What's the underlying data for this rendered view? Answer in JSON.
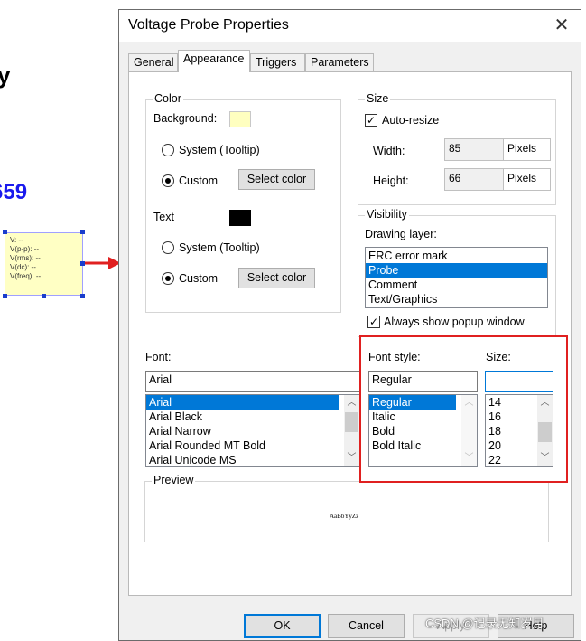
{
  "background": {
    "fragment_1": "y",
    "fragment_2": "659",
    "probe_lines": [
      "V: --",
      "V(p-p): --",
      "V(rms): --",
      "V(dc): --",
      "V(freq): --"
    ]
  },
  "dialog": {
    "title": "Voltage Probe Properties",
    "close_icon": "close-icon",
    "tabs": [
      "General",
      "Appearance",
      "Triggers",
      "Parameters"
    ],
    "active_tab": "Appearance"
  },
  "color_group": {
    "title": "Color",
    "background_label": "Background:",
    "background_color": "#ffffc0",
    "bg_system": "System (Tooltip)",
    "bg_custom": "Custom",
    "bg_select": "Select color",
    "text_label": "Text",
    "text_color": "#000000",
    "text_system": "System (Tooltip)",
    "text_custom": "Custom",
    "text_select": "Select color"
  },
  "size_group": {
    "title": "Size",
    "auto_resize": "Auto-resize",
    "width_label": "Width:",
    "width_value": "85",
    "height_label": "Height:",
    "height_value": "66",
    "unit": "Pixels"
  },
  "visibility_group": {
    "title": "Visibility",
    "drawing_layer_label": "Drawing layer:",
    "layers": [
      "ERC error mark",
      "Probe",
      "Comment",
      "Text/Graphics"
    ],
    "selected_layer": "Probe",
    "always_show": "Always show popup window"
  },
  "font": {
    "font_label": "Font:",
    "font_value": "Arial",
    "fonts": [
      "Arial",
      "Arial Black",
      "Arial Narrow",
      "Arial Rounded MT Bold",
      "Arial Unicode MS"
    ],
    "style_label": "Font style:",
    "style_value": "Regular",
    "styles": [
      "Regular",
      "Italic",
      "Bold",
      "Bold Italic"
    ],
    "size_label": "Size:",
    "size_value": "",
    "sizes": [
      "14",
      "16",
      "18",
      "20",
      "22"
    ]
  },
  "preview": {
    "title": "Preview",
    "sample": "AaBbYyZz"
  },
  "buttons": {
    "ok": "OK",
    "cancel": "Cancel",
    "apply": "Apply",
    "help": "Help"
  },
  "watermark": "CSDN @记录无知岁月"
}
